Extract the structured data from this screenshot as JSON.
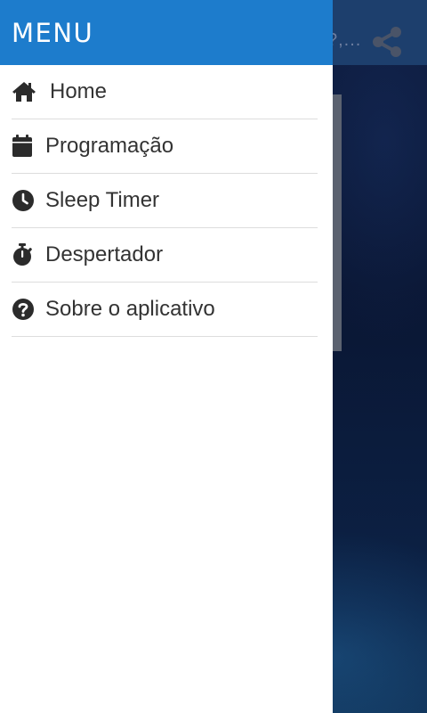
{
  "drawer": {
    "title": "MENU",
    "items": [
      {
        "label": "Home",
        "icon": "home-icon"
      },
      {
        "label": "Programação",
        "icon": "calendar-icon"
      },
      {
        "label": "Sleep Timer",
        "icon": "clock-icon"
      },
      {
        "label": "Despertador",
        "icon": "stopwatch-icon"
      },
      {
        "label": "Sobre o aplicativo",
        "icon": "question-circle-icon"
      }
    ]
  },
  "background_app": {
    "title_fragment": "?,...",
    "share_icon": "share-icon"
  },
  "colors": {
    "header_blue": "#1d7ccc",
    "text": "#333333",
    "divider": "#dddddd",
    "icon": "#2b2b2b"
  }
}
